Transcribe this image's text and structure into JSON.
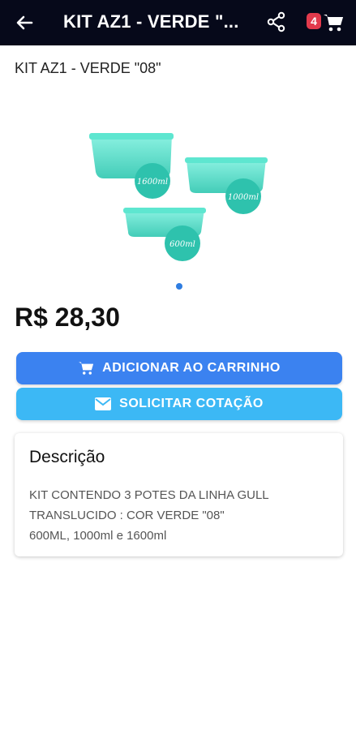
{
  "appbar": {
    "title": "KIT AZ1 - VERDE \"...",
    "cart_count": "4"
  },
  "product": {
    "name": "KIT AZ1 - VERDE \"08\"",
    "price": "R$ 28,30",
    "image_labels": [
      "1600ml",
      "1000ml",
      "600ml"
    ],
    "carousel_total": 1
  },
  "actions": {
    "add_to_cart_label": "ADICIONAR AO CARRINHO",
    "request_quote_label": "SOLICITAR COTAÇÃO"
  },
  "description": {
    "heading": "Descrição",
    "text": "KIT CONTENDO 3 POTES DA LINHA GULL\nTRANSLUCIDO : COR VERDE \"08\"\n600ML, 1000ml e 1600ml"
  },
  "colors": {
    "appbar_bg": "#06091a",
    "primary_button": "#3b82f0",
    "secondary_button": "#3cb8f5",
    "badge": "#e23a4c",
    "container_green": "#3fd6c0"
  }
}
